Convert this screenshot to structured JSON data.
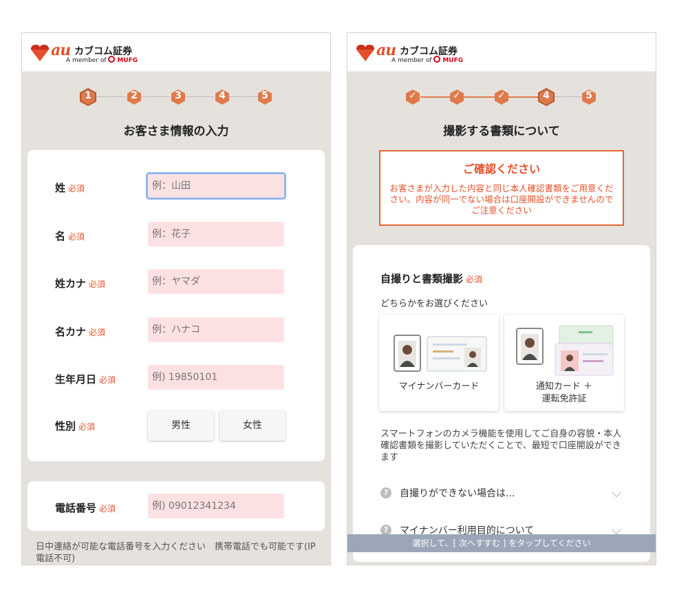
{
  "brand": {
    "logo_text": "au",
    "company": "カブコム証券",
    "sub_prefix": "A member of",
    "sub_group": "MUFG"
  },
  "colors": {
    "accent": "#e4502b",
    "step_active": "#e07a4a",
    "input_bg": "#fce1e3"
  },
  "left": {
    "steps": [
      "1",
      "2",
      "3",
      "4",
      "5"
    ],
    "active_step": 1,
    "title": "お客さま情報の入力",
    "required_label": "必須",
    "fields": [
      {
        "label": "姓",
        "placeholder": "例：山田"
      },
      {
        "label": "名",
        "placeholder": "例：花子"
      },
      {
        "label": "姓カナ",
        "placeholder": "例：ヤマダ"
      },
      {
        "label": "名カナ",
        "placeholder": "例：ハナコ"
      },
      {
        "label": "生年月日",
        "placeholder": "例) 19850101"
      }
    ],
    "gender": {
      "label": "性別",
      "male": "男性",
      "female": "女性"
    },
    "phone": {
      "label": "電話番号",
      "placeholder": "例) 09012341234"
    },
    "phone_note": "日中連絡が可能な電話番号を入力ください　携帯電話でも可能です(IP電話不可)"
  },
  "right": {
    "steps": [
      "✓",
      "✓",
      "✓",
      "4",
      "5"
    ],
    "active_step": 4,
    "title": "撮影する書類について",
    "confirm": {
      "title": "ご確認ください",
      "body": "お客さまが入力した内容と同じ本人確認書類をご用意ください。内容が同一でない場合は口座開設ができませんのでご注意ください"
    },
    "section_title": "自撮りと書類撮影",
    "required_label": "必須",
    "instruction": "どちらかをお選びください",
    "options": [
      {
        "label": "マイナンバーカード"
      },
      {
        "label_line1": "通知カード ＋",
        "label_line2": "運転免許証"
      }
    ],
    "description": "スマートフォンのカメラ機能を使用してご自身の容貌・本人確認書類を撮影していただくことで、最短で口座開設ができます",
    "faq": [
      {
        "q": "?",
        "text": "自撮りができない場合は..."
      },
      {
        "q": "?",
        "text": "マイナンバー利用目的について"
      }
    ],
    "bottom_bar": "選択して、[ 次へすすむ ] をタップしてください"
  }
}
